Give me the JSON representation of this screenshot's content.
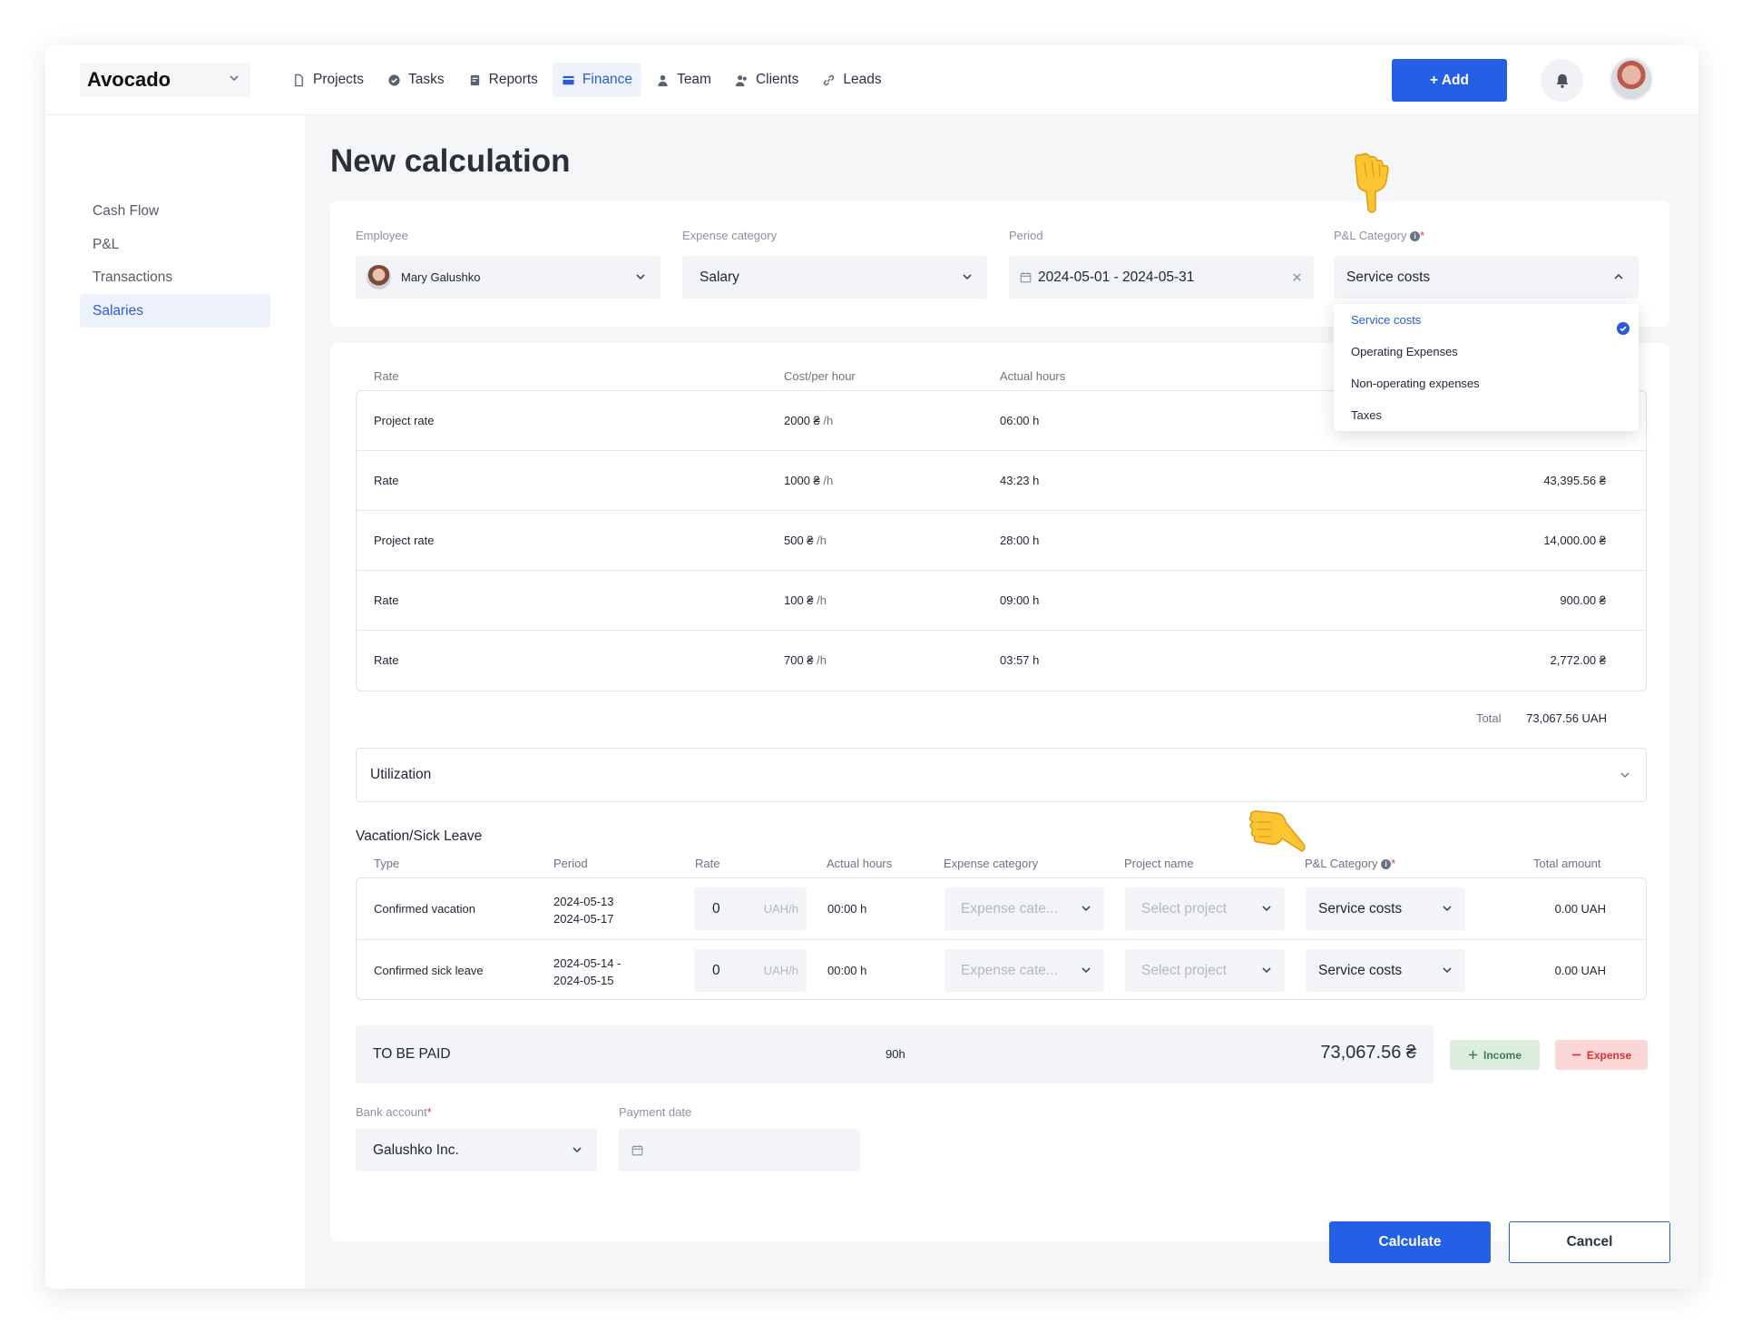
{
  "header": {
    "brand": "Avocado",
    "nav": [
      {
        "label": "Projects",
        "icon": "document-icon",
        "active": false
      },
      {
        "label": "Tasks",
        "icon": "check-circle-icon",
        "active": false
      },
      {
        "label": "Reports",
        "icon": "report-icon",
        "active": false
      },
      {
        "label": "Finance",
        "icon": "card-icon",
        "active": true
      },
      {
        "label": "Team",
        "icon": "person-icon",
        "active": false
      },
      {
        "label": "Clients",
        "icon": "people-icon",
        "active": false
      },
      {
        "label": "Leads",
        "icon": "link-icon",
        "active": false
      }
    ],
    "add_label": "+ Add"
  },
  "sidebar": {
    "items": [
      {
        "label": "Cash Flow",
        "active": false
      },
      {
        "label": "P&L",
        "active": false
      },
      {
        "label": "Transactions",
        "active": false
      },
      {
        "label": "Salaries",
        "active": true
      }
    ]
  },
  "page": {
    "title": "New calculation"
  },
  "filters": {
    "employee_label": "Employee",
    "employee_value": "Mary Galushko",
    "expense_label": "Expense category",
    "expense_value": "Salary",
    "period_label": "Period",
    "period_value": "2024-05-01 - 2024-05-31",
    "pl_label": "P&L Category",
    "pl_value": "Service costs",
    "pl_options": [
      "Service costs",
      "Operating Expenses",
      "Non-operating expenses",
      "Taxes"
    ]
  },
  "rates": {
    "headers": {
      "rate": "Rate",
      "cost": "Cost/per hour",
      "hours": "Actual hours"
    },
    "unit_suffix": "/h",
    "rows": [
      {
        "rate": "Project rate",
        "cost": "2000 ₴",
        "hours": "06:00 h",
        "amount": ""
      },
      {
        "rate": "Rate",
        "cost": "1000 ₴",
        "hours": "43:23 h",
        "amount": "43,395.56 ₴"
      },
      {
        "rate": "Project rate",
        "cost": "500 ₴",
        "hours": "28:00 h",
        "amount": "14,000.00 ₴"
      },
      {
        "rate": "Rate",
        "cost": "100 ₴",
        "hours": "09:00 h",
        "amount": "900.00 ₴"
      },
      {
        "rate": "Rate",
        "cost": "700 ₴",
        "hours": "03:57 h",
        "amount": "2,772.00 ₴"
      }
    ],
    "total_label": "Total",
    "total_value": "73,067.56 UAH"
  },
  "utilization": {
    "label": "Utilization"
  },
  "vacation": {
    "title": "Vacation/Sick Leave",
    "headers": {
      "type": "Type",
      "period": "Period",
      "rate": "Rate",
      "hours": "Actual hours",
      "expense": "Expense category",
      "project": "Project name",
      "pl": "P&L Category",
      "total": "Total amount"
    },
    "rows": [
      {
        "type": "Confirmed vacation",
        "period1": "2024-05-13",
        "period2": "2024-05-17",
        "rate": "0",
        "rate_unit": "UAH/h",
        "hours": "00:00 h",
        "expense": "Expense cate...",
        "project": "Select project",
        "pl": "Service costs",
        "total": "0.00 UAH"
      },
      {
        "type": "Confirmed sick leave",
        "period1": "2024-05-14 -",
        "period2": "2024-05-15",
        "rate": "0",
        "rate_unit": "UAH/h",
        "hours": "00:00 h",
        "expense": "Expense cate...",
        "project": "Select project",
        "pl": "Service costs",
        "total": "0.00 UAH"
      }
    ]
  },
  "payment": {
    "label": "TO BE PAID",
    "hours": "90h",
    "amount": "73,067.56 ₴",
    "income_label": "Income",
    "expense_label": "Expense",
    "bank_label": "Bank account",
    "bank_value": "Galushko Inc.",
    "date_label": "Payment date",
    "date_value": ""
  },
  "actions": {
    "calculate": "Calculate",
    "cancel": "Cancel"
  },
  "colors": {
    "accent": "#2360e6",
    "income_bg": "#dcefdf",
    "expense_bg": "#fbd7d8"
  }
}
